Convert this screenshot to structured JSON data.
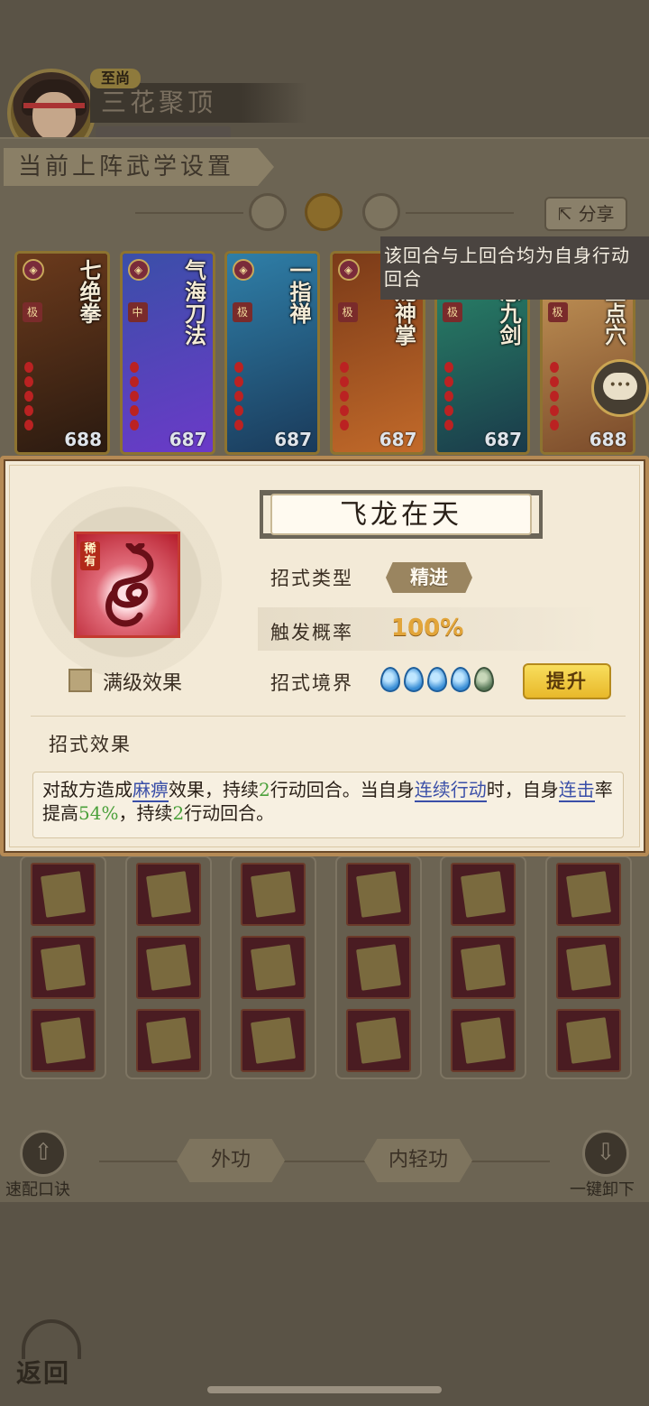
{
  "header": {
    "rank_tag": "至尚",
    "player_title": "三花聚顶"
  },
  "section_title": "当前上阵武学设置",
  "share_label": "分享",
  "cards": [
    {
      "name": "七绝拳",
      "grade": "极",
      "count": "688",
      "art": [
        "#6b3a1c",
        "#2a1a10"
      ]
    },
    {
      "name": "气海刀法",
      "grade": "中",
      "count": "687",
      "art": [
        "#3a4fa8",
        "#6b3ac8"
      ]
    },
    {
      "name": "一指禅",
      "grade": "极",
      "count": "687",
      "art": [
        "#2f7fa8",
        "#1a3a5a"
      ]
    },
    {
      "name": "飞龙神掌",
      "grade": "极",
      "count": "687",
      "art": [
        "#7a3a18",
        "#c26a2a"
      ]
    },
    {
      "name": "王慈九剑",
      "grade": "极",
      "count": "687",
      "art": [
        "#2a8a6a",
        "#1a3a4a"
      ]
    },
    {
      "name": "天竺点穴",
      "grade": "极",
      "count": "688",
      "art": [
        "#c89a5a",
        "#7a4a2a"
      ]
    }
  ],
  "detail": {
    "skill_name": "飞龙在天",
    "rare_tag": "稀有",
    "max_effect_label": "满级效果",
    "type_label": "招式类型",
    "type_value": "精进",
    "prob_label": "触发概率",
    "prob_value": "100%",
    "realm_label": "招式境界",
    "realm_level": 4,
    "realm_max": 5,
    "upgrade_label": "提升",
    "tooltip": "该回合与上回合均为自身行动回合",
    "effect_label": "招式效果",
    "effect": {
      "p1": "对敌方造成",
      "kw1": "麻痹",
      "p2": "效果，持续",
      "n1": "2",
      "p3": "行动回合。当自身",
      "kw2": "连续行动",
      "p4": "时，自身",
      "kw3": "连击",
      "p5": "率提高",
      "n2": "54%",
      "p6": "，持续",
      "n3": "2",
      "p7": "行动回合。"
    }
  },
  "bottom": {
    "quick_label": "速配口诀",
    "tab_outer": "外功",
    "tab_inner": "内轻功",
    "unload_label": "一键卸下",
    "back_label": "返回"
  },
  "colors": {
    "accent_gold": "#e2a53a",
    "keyword_blue": "#3a4fa8",
    "number_green": "#4aa03a",
    "popup_bg": "#f3ead7"
  }
}
